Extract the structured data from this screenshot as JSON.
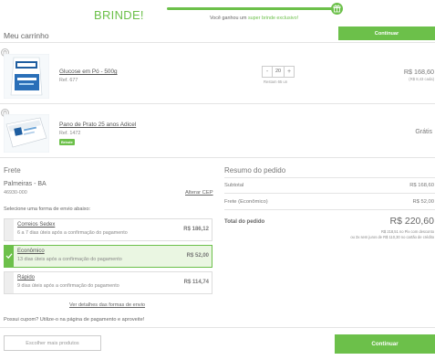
{
  "banner": {
    "title": "BRINDE!",
    "msg_before": "Você ganhou um ",
    "msg_highlight": "super brinde exclusivo!",
    "progress_percent": 100
  },
  "cart": {
    "title": "Meu carrinho",
    "continue_label": "Continuar"
  },
  "products": [
    {
      "name": "Glucose em Pó - 500g",
      "ref": "Ref. 677",
      "quantity": "20",
      "stock_note": "Restam 65 un",
      "price": "R$ 168,60",
      "price_note": "(R$ 8,43 cada)"
    },
    {
      "name": "Pano de Prato 25 anos Adicel",
      "ref": "Ref. 1472",
      "badge": "Brinde",
      "price": "Grátis"
    }
  ],
  "freight": {
    "title": "Frete",
    "city": "Palmeiras - BA",
    "cep": "46930-000",
    "change_cep": "Alterar CEP",
    "select_label": "Selecione uma forma de envio abaixo:",
    "options": [
      {
        "name": "Correios Sedex",
        "desc": "6 a 7 dias úteis após a confirmação do pagamento",
        "price": "R$ 186,12",
        "selected": false
      },
      {
        "name": "Econômico",
        "desc": "13 dias úteis após a confirmação do pagamento",
        "price": "R$ 52,00",
        "selected": true
      },
      {
        "name": "Rápido",
        "desc": "9 dias úteis após a confirmação do pagamento",
        "price": "R$ 114,74",
        "selected": false
      }
    ],
    "details_link": "Ver detalhes das formas de envio",
    "coupon_text": "Possui cupom? Utilize-o na página de pagamento e aproveite!"
  },
  "summary": {
    "title": "Resumo do pedido",
    "subtotal_label": "Subtotal",
    "subtotal_value": "R$ 168,60",
    "freight_label": "Frete (Econômico)",
    "freight_value": "R$ 52,00",
    "total_label": "Total do pedido",
    "total_value": "R$ 220,60",
    "note_pix": "R$ 218,51 no Pix com desconto",
    "note_card": "ou 3x sem juros de R$ 110,30 no cartão de crédito"
  },
  "footer": {
    "more_label": "Escolher mais produtos",
    "continue_label": "Continuar"
  },
  "colors": {
    "accent": "#6cc04a"
  }
}
